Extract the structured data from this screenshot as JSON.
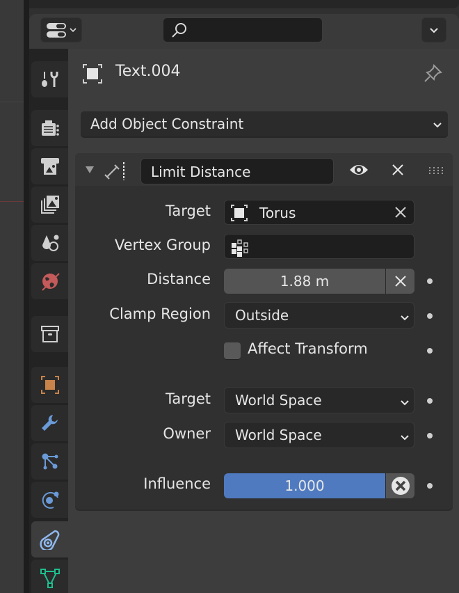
{
  "header": {
    "editor_type_icon": "properties-editor-icon",
    "search_placeholder": "",
    "options_icon": "chevron-down-icon"
  },
  "tabs": [
    {
      "name": "tool",
      "icon": "tool-icon",
      "active": false
    },
    {
      "name": "render",
      "icon": "render-icon",
      "active": false
    },
    {
      "name": "output",
      "icon": "output-icon",
      "active": false
    },
    {
      "name": "view-layer",
      "icon": "view-layer-icon",
      "active": false
    },
    {
      "name": "scene",
      "icon": "scene-icon",
      "active": false
    },
    {
      "name": "world",
      "icon": "world-icon",
      "active": false
    },
    {
      "name": "collection",
      "icon": "collection-icon",
      "active": false
    },
    {
      "name": "object",
      "icon": "object-icon",
      "active": false
    },
    {
      "name": "modifiers",
      "icon": "wrench-icon",
      "active": false
    },
    {
      "name": "particles",
      "icon": "particles-icon",
      "active": false
    },
    {
      "name": "physics",
      "icon": "physics-icon",
      "active": false
    },
    {
      "name": "object-constraints",
      "icon": "constraint-icon",
      "active": true
    },
    {
      "name": "object-data",
      "icon": "mesh-data-icon",
      "active": false
    }
  ],
  "object": {
    "name": "Text.004"
  },
  "add_constraint": {
    "label": "Add Object Constraint"
  },
  "constraint": {
    "name": "Limit Distance",
    "fields": {
      "target_label": "Target",
      "target_value": "Torus",
      "vertex_group_label": "Vertex Group",
      "vertex_group_value": "",
      "distance_label": "Distance",
      "distance_value": "1.88 m",
      "clamp_region_label": "Clamp Region",
      "clamp_region_value": "Outside",
      "affect_transform_label": "Affect Transform",
      "affect_transform_checked": false,
      "target_space_label": "Target",
      "target_space_value": "World Space",
      "owner_space_label": "Owner",
      "owner_space_value": "World Space",
      "influence_label": "Influence",
      "influence_value": "1.000",
      "influence_fraction": 1.0
    }
  },
  "colors": {
    "accent_blue": "#4f7ac0",
    "object_orange": "#c8834a",
    "world_red": "#c45a5a",
    "data_green": "#1fbf8f",
    "modifier_blue": "#6a9ad8"
  }
}
